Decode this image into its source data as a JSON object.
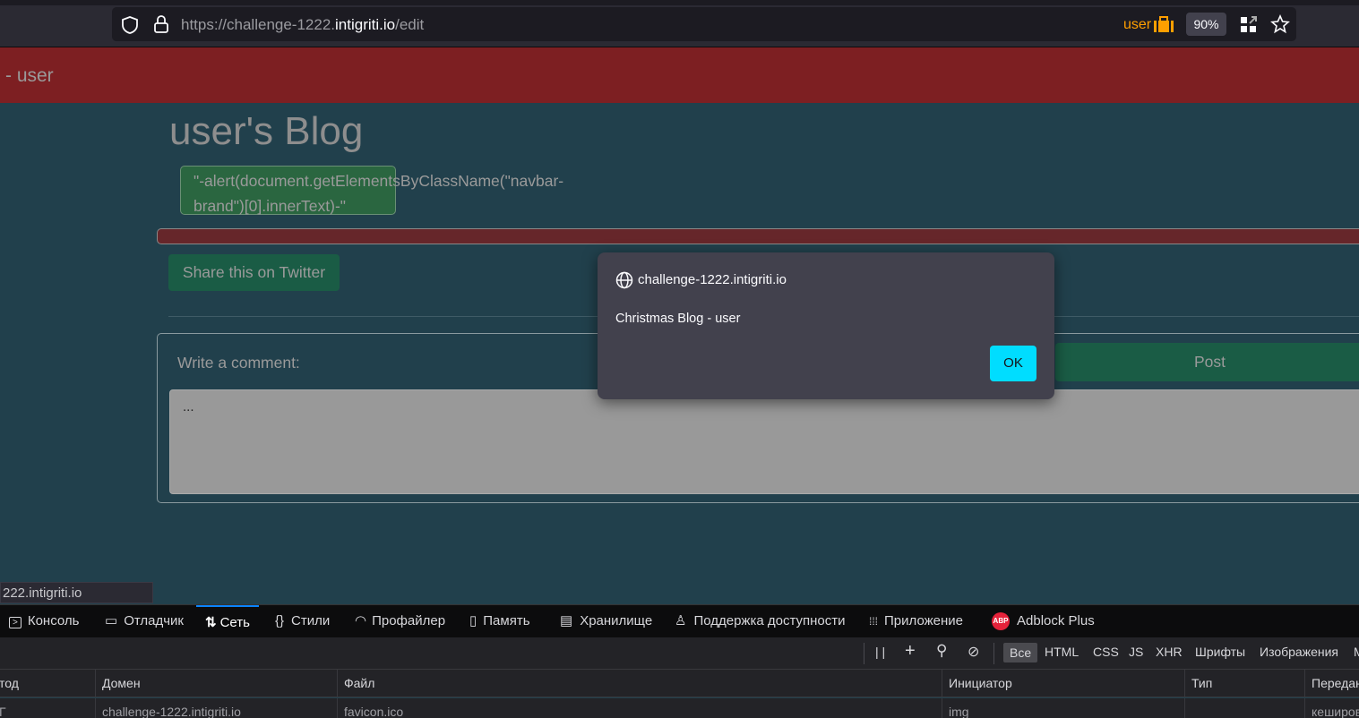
{
  "browser": {
    "url_prefix": "https://challenge-1222.",
    "url_domain": "intigriti.io",
    "url_suffix": "/edit",
    "container_label": "user",
    "zoom": "90%"
  },
  "page": {
    "navbar_brand": "- user",
    "title": "user's Blog",
    "post_content": "\"-alert(document.getElementsByClassName(\"navbar-brand\")[0].innerText)-\"",
    "share_label": "Share this on Twitter",
    "comment_label": "Write a comment:",
    "post_label": "Post",
    "comment_value": "..."
  },
  "dialog": {
    "origin": "challenge-1222.intigriti.io",
    "message": "Christmas Blog - user",
    "ok_label": "OK"
  },
  "status_url": "222.intigriti.io",
  "devtools": {
    "tabs": [
      "Консоль",
      "Отладчик",
      "Сеть",
      "Стили",
      "Профайлер",
      "Память",
      "Хранилище",
      "Поддержка доступности",
      "Приложение",
      "Adblock Plus"
    ],
    "filters": [
      "Все",
      "HTML",
      "CSS",
      "JS",
      "XHR",
      "Шрифты",
      "Изображения",
      "M"
    ],
    "columns": [
      "тод",
      "Домен",
      "Файл",
      "Инициатор",
      "Тип",
      "Передан"
    ],
    "rows": [
      {
        "method": "Г",
        "domain": "challenge-1222.intigriti.io",
        "file": "favicon.ico",
        "initiator": "img",
        "type": "",
        "transferred": "кеширов"
      }
    ]
  }
}
